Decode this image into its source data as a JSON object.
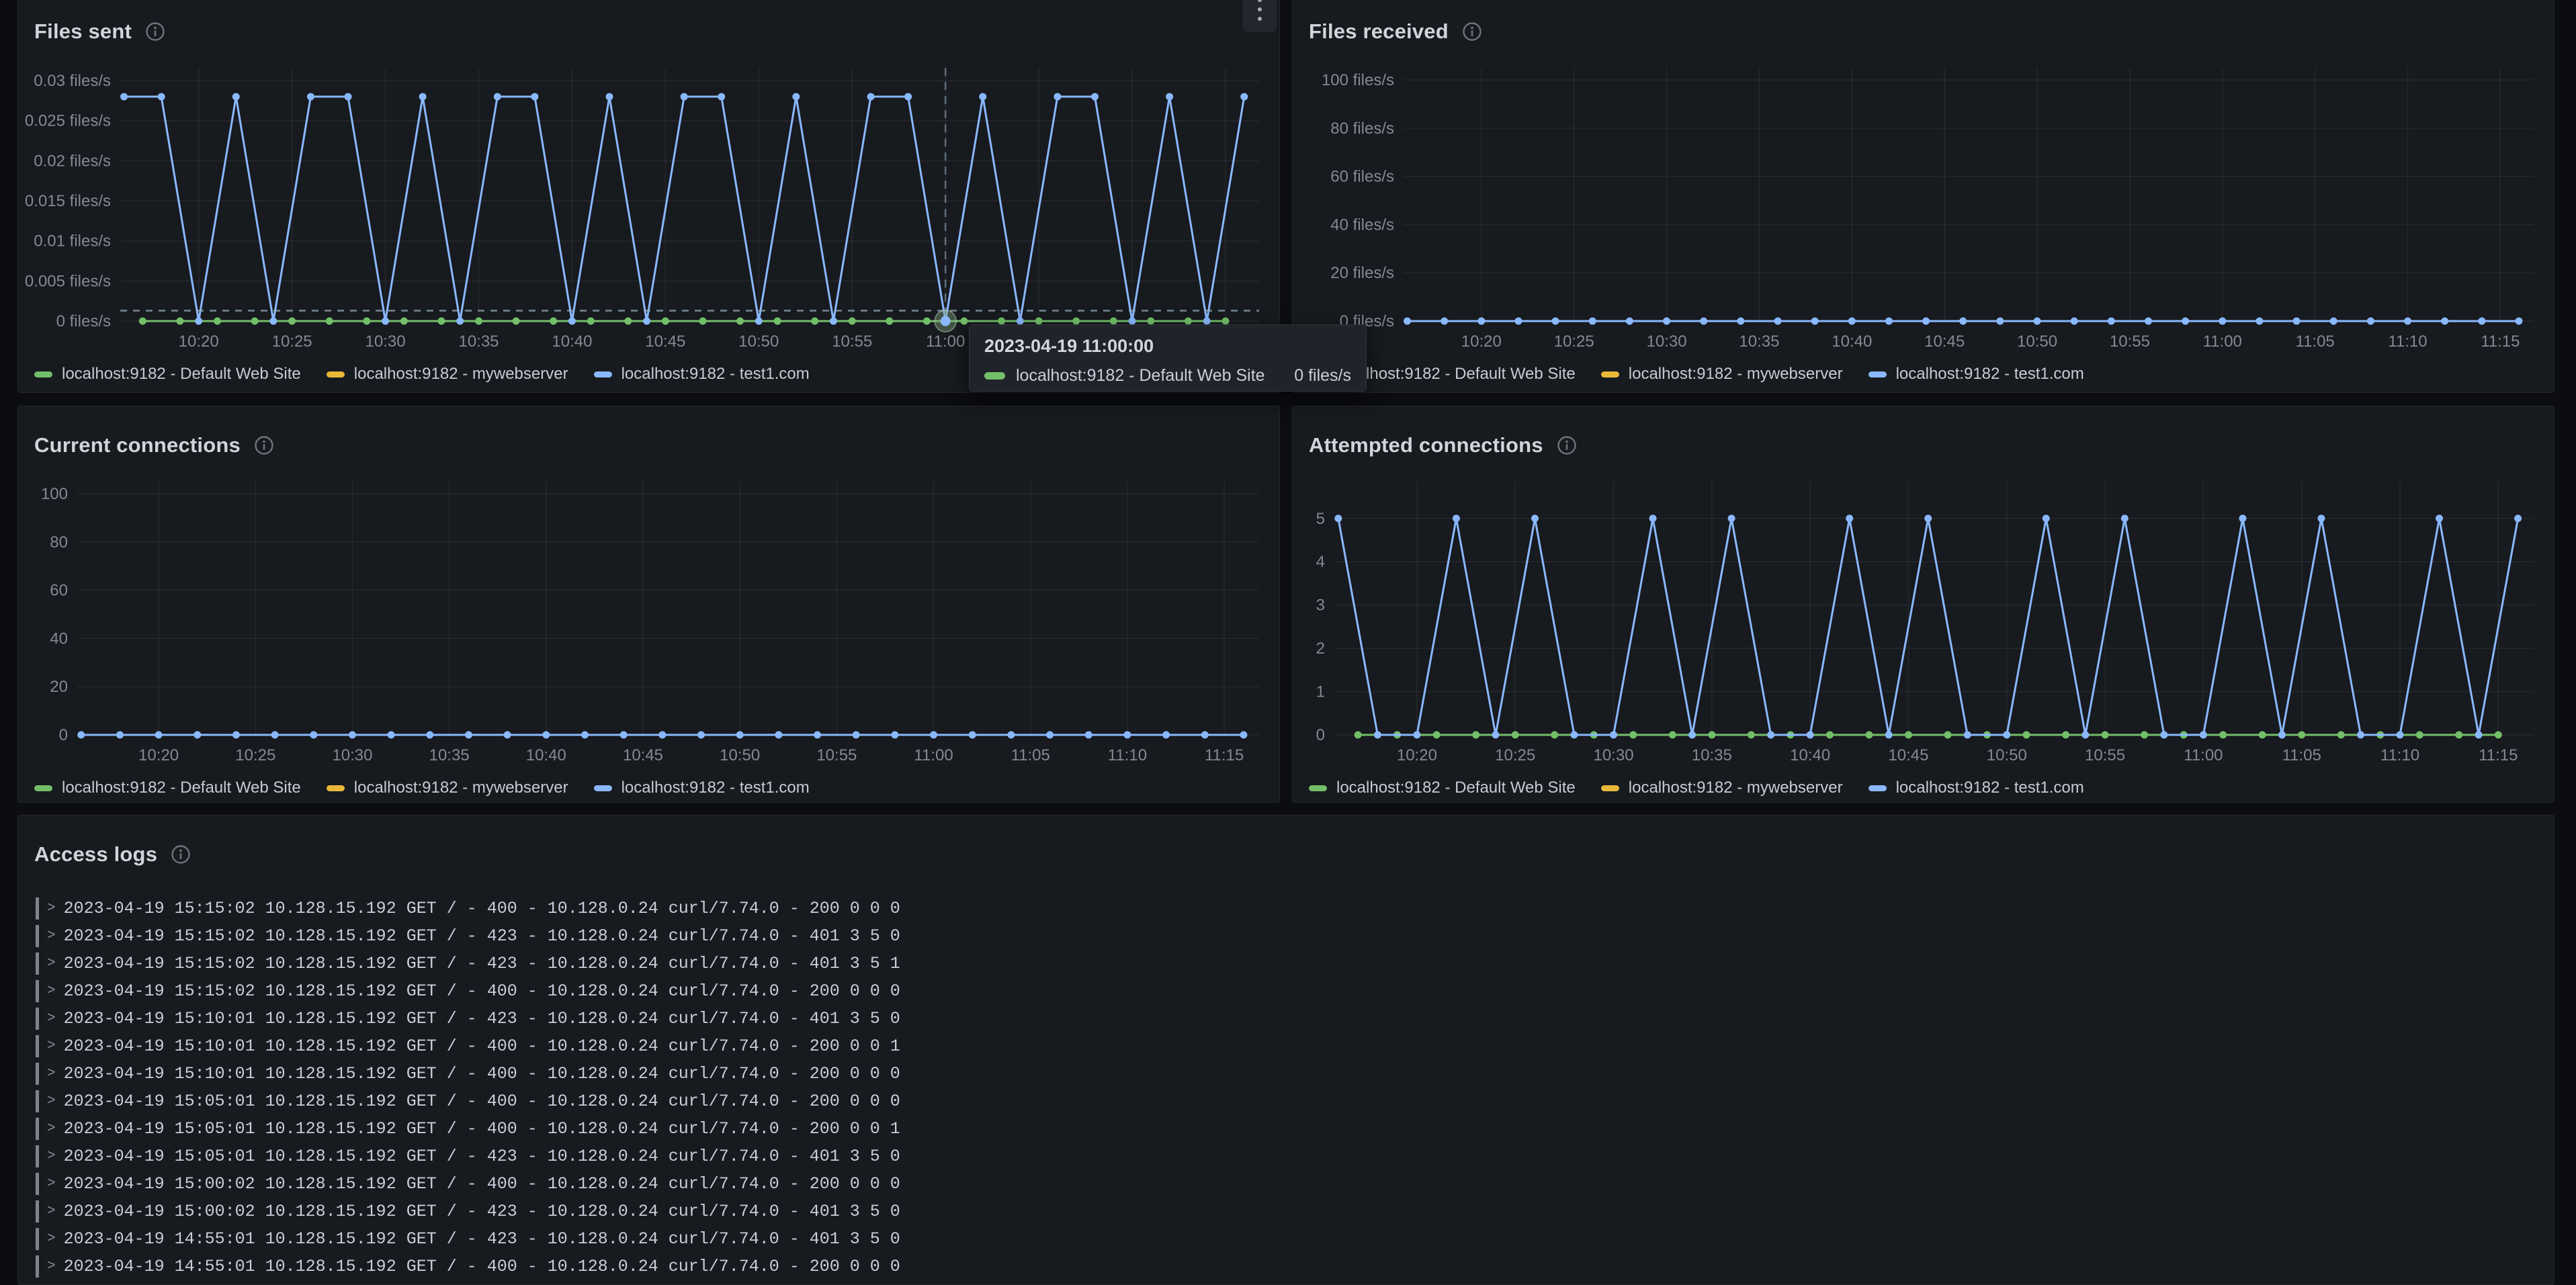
{
  "panels": {
    "files_sent": {
      "title": "Files sent"
    },
    "files_received": {
      "title": "Files received"
    },
    "current_connections": {
      "title": "Current connections"
    },
    "attempted_connections": {
      "title": "Attempted connections"
    },
    "access_logs": {
      "title": "Access logs"
    }
  },
  "icons": {
    "info": "info-icon",
    "panel_menu": "kebab-menu-icon",
    "log_expand_chevron": ">"
  },
  "colors": {
    "page_bg": "#0c0d11",
    "panel_bg": "#171a1e",
    "panel_border": "#24262c",
    "grid": "rgba(204,204,220,0.08)",
    "axis_text": "rgba(204,204,220,0.62)",
    "title_text": "#d3d4db",
    "green": "#73bf69",
    "yellow": "#eab839",
    "blue": "#8ab8ff",
    "crosshair": "rgba(149,175,192,0.75)"
  },
  "legend": {
    "items": [
      {
        "label": "localhost:9182 - Default Web Site",
        "color": "#73bf69"
      },
      {
        "label": "localhost:9182 - mywebserver",
        "color": "#eab839"
      },
      {
        "label": "localhost:9182 - test1.com",
        "color": "#8ab8ff"
      }
    ]
  },
  "x_axis": {
    "tick_minutes": [
      20,
      25,
      30,
      35,
      40,
      45,
      50,
      55,
      60,
      65,
      70,
      75
    ],
    "tick_labels": [
      "10:20",
      "10:25",
      "10:30",
      "10:35",
      "10:40",
      "10:45",
      "10:50",
      "10:55",
      "11:00",
      "11:05",
      "11:10",
      "11:15"
    ]
  },
  "tooltip": {
    "time": "2023-04-19 11:00:00",
    "series": "localhost:9182 - Default Web Site",
    "value": "0 files/s",
    "color": "#73bf69"
  },
  "chart_data": [
    {
      "id": "files_sent",
      "type": "line",
      "title": "Files sent",
      "x_unit": "time (minutes after 10:00)",
      "x_domain": [
        15.8,
        76.8
      ],
      "y_max": 0.0316,
      "ylim": [
        0,
        0.0316
      ],
      "grid": true,
      "legend_position": "bottom",
      "margins": {
        "l": 152,
        "r": 30,
        "t": 22,
        "b": 56
      },
      "y_ticks": [
        {
          "v": 0.03,
          "label": "0.03 files/s"
        },
        {
          "v": 0.025,
          "label": "0.025 files/s"
        },
        {
          "v": 0.02,
          "label": "0.02 files/s"
        },
        {
          "v": 0.015,
          "label": "0.015 files/s"
        },
        {
          "v": 0.01,
          "label": "0.01 files/s"
        },
        {
          "v": 0.005,
          "label": "0.005 files/s"
        },
        {
          "v": 0,
          "label": "0 files/s"
        }
      ],
      "series": [
        {
          "name": "localhost:9182 - mywebserver",
          "color": "#eab839",
          "x_start": 17,
          "x_step": 2,
          "markers": false,
          "values": [
            0,
            0,
            0,
            0,
            0,
            0,
            0,
            0,
            0,
            0,
            0,
            0,
            0,
            0,
            0,
            0,
            0,
            0,
            0,
            0,
            0,
            0,
            0,
            0,
            0,
            0,
            0,
            0,
            0,
            0
          ]
        },
        {
          "name": "localhost:9182 - Default Web Site",
          "color": "#73bf69",
          "x_start": 17,
          "x_step": 2,
          "markers": true,
          "values": [
            0,
            0,
            0,
            0,
            0,
            0,
            0,
            0,
            0,
            0,
            0,
            0,
            0,
            0,
            0,
            0,
            0,
            0,
            0,
            0,
            0,
            0,
            0,
            0,
            0,
            0,
            0,
            0,
            0,
            0
          ]
        },
        {
          "name": "localhost:9182 - test1.com",
          "color": "#8ab8ff",
          "x_start": 16,
          "x_step": 2,
          "markers": true,
          "values": [
            0.028,
            0.028,
            0,
            0.028,
            0,
            0.028,
            0.028,
            0,
            0.028,
            0,
            0.028,
            0.028,
            0,
            0.028,
            0,
            0.028,
            0.028,
            0,
            0.028,
            0,
            0.028,
            0.028,
            0,
            0.028,
            0,
            0.028,
            0.028,
            0,
            0.028,
            0,
            0.028
          ]
        }
      ],
      "crosshair": {
        "t": 60,
        "y_value": 0.0013,
        "highlight": {
          "t": 60,
          "v": 0,
          "ring_color": "rgba(125,165,125,0.42)",
          "dot_color": "#8ab8ff"
        }
      }
    },
    {
      "id": "files_received",
      "type": "line",
      "title": "Files received",
      "x_unit": "time (minutes after 10:00)",
      "x_domain": [
        15.8,
        76.8
      ],
      "y_max": 105,
      "ylim": [
        0,
        105
      ],
      "grid": true,
      "legend_position": "bottom",
      "margins": {
        "l": 165,
        "r": 30,
        "t": 22,
        "b": 56
      },
      "y_ticks": [
        {
          "v": 100,
          "label": "100 files/s"
        },
        {
          "v": 80,
          "label": "80 files/s"
        },
        {
          "v": 60,
          "label": "60 files/s"
        },
        {
          "v": 40,
          "label": "40 files/s"
        },
        {
          "v": 20,
          "label": "20 files/s"
        },
        {
          "v": 0,
          "label": "0 files/s"
        }
      ],
      "series": [
        {
          "name": "localhost:9182 - mywebserver",
          "color": "#eab839",
          "x_start": 17,
          "x_step": 2,
          "markers": false,
          "values": [
            0,
            0,
            0,
            0,
            0,
            0,
            0,
            0,
            0,
            0,
            0,
            0,
            0,
            0,
            0,
            0,
            0,
            0,
            0,
            0,
            0,
            0,
            0,
            0,
            0,
            0,
            0,
            0,
            0,
            0
          ]
        },
        {
          "name": "localhost:9182 - Default Web Site",
          "color": "#73bf69",
          "x_start": 17,
          "x_step": 2,
          "markers": false,
          "values": [
            0,
            0,
            0,
            0,
            0,
            0,
            0,
            0,
            0,
            0,
            0,
            0,
            0,
            0,
            0,
            0,
            0,
            0,
            0,
            0,
            0,
            0,
            0,
            0,
            0,
            0,
            0,
            0,
            0,
            0
          ]
        },
        {
          "name": "localhost:9182 - test1.com",
          "color": "#8ab8ff",
          "x_start": 16,
          "x_step": 2,
          "markers": true,
          "values": [
            0,
            0,
            0,
            0,
            0,
            0,
            0,
            0,
            0,
            0,
            0,
            0,
            0,
            0,
            0,
            0,
            0,
            0,
            0,
            0,
            0,
            0,
            0,
            0,
            0,
            0,
            0,
            0,
            0,
            0,
            0
          ]
        }
      ]
    },
    {
      "id": "current_connections",
      "type": "line",
      "title": "Current connections",
      "x_unit": "time (minutes after 10:00)",
      "x_domain": [
        15.8,
        76.8
      ],
      "y_max": 105,
      "ylim": [
        0,
        105
      ],
      "grid": true,
      "legend_position": "bottom",
      "margins": {
        "l": 88,
        "r": 30,
        "t": 22,
        "b": 56
      },
      "y_ticks": [
        {
          "v": 100,
          "label": "100"
        },
        {
          "v": 80,
          "label": "80"
        },
        {
          "v": 60,
          "label": "60"
        },
        {
          "v": 40,
          "label": "40"
        },
        {
          "v": 20,
          "label": "20"
        },
        {
          "v": 0,
          "label": "0"
        }
      ],
      "series": [
        {
          "name": "localhost:9182 - mywebserver",
          "color": "#eab839",
          "x_start": 17,
          "x_step": 2,
          "markers": false,
          "values": [
            0,
            0,
            0,
            0,
            0,
            0,
            0,
            0,
            0,
            0,
            0,
            0,
            0,
            0,
            0,
            0,
            0,
            0,
            0,
            0,
            0,
            0,
            0,
            0,
            0,
            0,
            0,
            0,
            0,
            0
          ]
        },
        {
          "name": "localhost:9182 - Default Web Site",
          "color": "#73bf69",
          "x_start": 17,
          "x_step": 2,
          "markers": false,
          "values": [
            0,
            0,
            0,
            0,
            0,
            0,
            0,
            0,
            0,
            0,
            0,
            0,
            0,
            0,
            0,
            0,
            0,
            0,
            0,
            0,
            0,
            0,
            0,
            0,
            0,
            0,
            0,
            0,
            0,
            0
          ]
        },
        {
          "name": "localhost:9182 - test1.com",
          "color": "#8ab8ff",
          "x_start": 16,
          "x_step": 2,
          "markers": true,
          "values": [
            0,
            0,
            0,
            0,
            0,
            0,
            0,
            0,
            0,
            0,
            0,
            0,
            0,
            0,
            0,
            0,
            0,
            0,
            0,
            0,
            0,
            0,
            0,
            0,
            0,
            0,
            0,
            0,
            0,
            0,
            0
          ]
        }
      ]
    },
    {
      "id": "attempted_connections",
      "type": "line",
      "title": "Attempted connections",
      "x_unit": "time (minutes after 10:00)",
      "x_domain": [
        15.8,
        76.8
      ],
      "y_max": 5.85,
      "ylim": [
        0,
        5.85
      ],
      "grid": true,
      "legend_position": "bottom",
      "margins": {
        "l": 62,
        "r": 30,
        "t": 22,
        "b": 56
      },
      "y_ticks": [
        {
          "v": 5,
          "label": "5"
        },
        {
          "v": 4,
          "label": "4"
        },
        {
          "v": 3,
          "label": "3"
        },
        {
          "v": 2,
          "label": "2"
        },
        {
          "v": 1,
          "label": "1"
        },
        {
          "v": 0,
          "label": "0"
        }
      ],
      "series": [
        {
          "name": "localhost:9182 - mywebserver",
          "color": "#eab839",
          "x_start": 17,
          "x_step": 2,
          "markers": false,
          "values": [
            0,
            0,
            0,
            0,
            0,
            0,
            0,
            0,
            0,
            0,
            0,
            0,
            0,
            0,
            0,
            0,
            0,
            0,
            0,
            0,
            0,
            0,
            0,
            0,
            0,
            0,
            0,
            0,
            0,
            0
          ]
        },
        {
          "name": "localhost:9182 - Default Web Site",
          "color": "#73bf69",
          "x_start": 17,
          "x_step": 2,
          "markers": true,
          "values": [
            0,
            0,
            0,
            0,
            0,
            0,
            0,
            0,
            0,
            0,
            0,
            0,
            0,
            0,
            0,
            0,
            0,
            0,
            0,
            0,
            0,
            0,
            0,
            0,
            0,
            0,
            0,
            0,
            0,
            0
          ]
        },
        {
          "name": "localhost:9182 - test1.com",
          "color": "#8ab8ff",
          "x_start": 16,
          "x_step": 2,
          "markers": true,
          "values": [
            5,
            0,
            0,
            5,
            0,
            5,
            0,
            0,
            5,
            0,
            5,
            0,
            0,
            5,
            0,
            5,
            0,
            0,
            5,
            0,
            5,
            0,
            0,
            5,
            0,
            5,
            0,
            0,
            5,
            0,
            5
          ]
        }
      ]
    }
  ],
  "logs": {
    "chevron": ">",
    "rows": [
      "2023-04-19 15:15:02 10.128.15.192 GET / - 400 - 10.128.0.24 curl/7.74.0 - 200 0 0 0",
      "2023-04-19 15:15:02 10.128.15.192 GET / - 423 - 10.128.0.24 curl/7.74.0 - 401 3 5 0",
      "2023-04-19 15:15:02 10.128.15.192 GET / - 423 - 10.128.0.24 curl/7.74.0 - 401 3 5 1",
      "2023-04-19 15:15:02 10.128.15.192 GET / - 400 - 10.128.0.24 curl/7.74.0 - 200 0 0 0",
      "2023-04-19 15:10:01 10.128.15.192 GET / - 423 - 10.128.0.24 curl/7.74.0 - 401 3 5 0",
      "2023-04-19 15:10:01 10.128.15.192 GET / - 400 - 10.128.0.24 curl/7.74.0 - 200 0 0 1",
      "2023-04-19 15:10:01 10.128.15.192 GET / - 400 - 10.128.0.24 curl/7.74.0 - 200 0 0 0",
      "2023-04-19 15:05:01 10.128.15.192 GET / - 400 - 10.128.0.24 curl/7.74.0 - 200 0 0 0",
      "2023-04-19 15:05:01 10.128.15.192 GET / - 400 - 10.128.0.24 curl/7.74.0 - 200 0 0 1",
      "2023-04-19 15:05:01 10.128.15.192 GET / - 423 - 10.128.0.24 curl/7.74.0 - 401 3 5 0",
      "2023-04-19 15:00:02 10.128.15.192 GET / - 400 - 10.128.0.24 curl/7.74.0 - 200 0 0 0",
      "2023-04-19 15:00:02 10.128.15.192 GET / - 423 - 10.128.0.24 curl/7.74.0 - 401 3 5 0",
      "2023-04-19 14:55:01 10.128.15.192 GET / - 423 - 10.128.0.24 curl/7.74.0 - 401 3 5 0",
      "2023-04-19 14:55:01 10.128.15.192 GET / - 400 - 10.128.0.24 curl/7.74.0 - 200 0 0 0"
    ]
  }
}
